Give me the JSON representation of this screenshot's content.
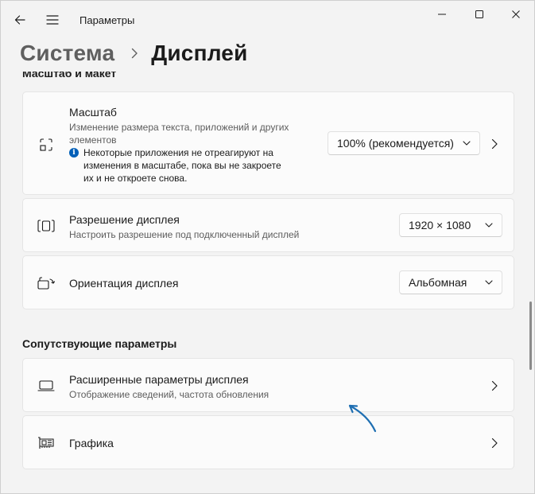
{
  "window": {
    "title": "Параметры"
  },
  "breadcrumb": {
    "parent": "Система",
    "current": "Дисплей"
  },
  "sections": {
    "scale_layout_title": "Масштаб и макет",
    "related_title": "Сопутствующие параметры"
  },
  "scale": {
    "title": "Масштаб",
    "subtitle": "Изменение размера текста, приложений и других элементов",
    "info": "Некоторые приложения не отреагируют на изменения в масштабе, пока вы не закроете их и не откроете снова.",
    "value": "100% (рекомендуется)"
  },
  "resolution": {
    "title": "Разрешение дисплея",
    "subtitle": "Настроить разрешение под подключенный дисплей",
    "value": "1920 × 1080"
  },
  "orientation": {
    "title": "Ориентация дисплея",
    "value": "Альбомная"
  },
  "advanced": {
    "title": "Расширенные параметры дисплея",
    "subtitle": "Отображение сведений, частота обновления"
  },
  "graphics": {
    "title": "Графика"
  },
  "colors": {
    "accent": "#005fb8",
    "annotation_arrow": "#1f6fb2"
  }
}
